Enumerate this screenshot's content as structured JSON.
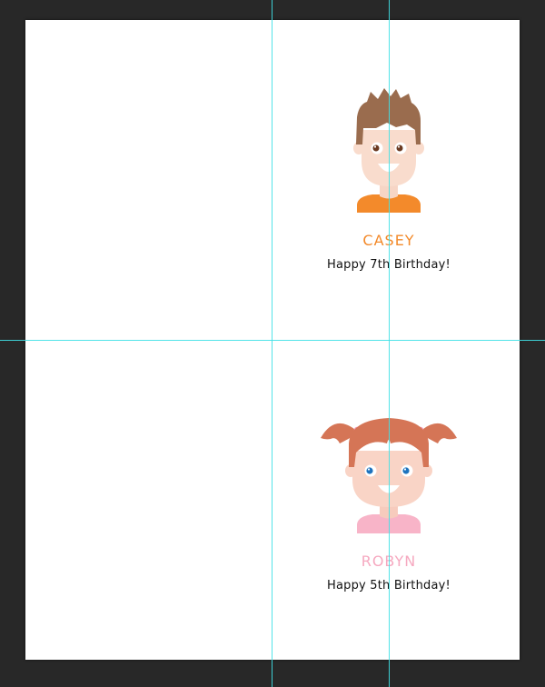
{
  "colors": {
    "workspace": "#282828",
    "artboard": "#ffffff",
    "guide": "#3fe0e6",
    "casey_name": "#f38a2b",
    "robyn_name": "#f6a9c0"
  },
  "cards": [
    {
      "name": "CASEY",
      "message": "Happy 7th Birthday!",
      "avatar_icon": "boy-avatar-icon"
    },
    {
      "name": "ROBYN",
      "message": "Happy 5th Birthday!",
      "avatar_icon": "girl-avatar-icon"
    }
  ]
}
